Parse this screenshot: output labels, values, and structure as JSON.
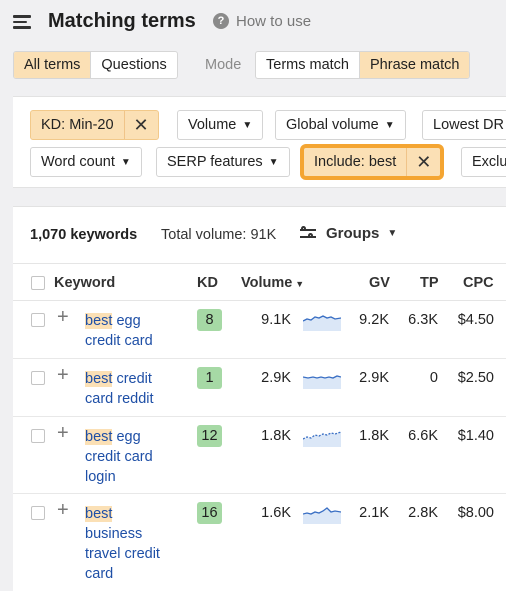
{
  "header": {
    "title": "Matching terms",
    "help_icon_glyph": "?",
    "help_text": "How to use"
  },
  "tabs": {
    "all_terms": "All terms",
    "questions": "Questions",
    "mode_label": "Mode",
    "terms_match": "Terms match",
    "phrase_match": "Phrase match"
  },
  "filters": {
    "kd": "KD: Min-20",
    "volume": "Volume",
    "global_volume": "Global volume",
    "lowest_dr": "Lowest DR",
    "word_count": "Word count",
    "serp_features": "SERP features",
    "include": "Include: best",
    "exclude": "Exclude",
    "close_glyph": "✕",
    "caret_glyph": "▼"
  },
  "summary": {
    "keywords": "1,070 keywords",
    "total_volume": "Total volume: 91K",
    "groups_label": "Groups"
  },
  "columns": {
    "keyword": "Keyword",
    "kd": "KD",
    "volume": "Volume",
    "gv": "GV",
    "tp": "TP",
    "cpc": "CPC"
  },
  "rows": [
    {
      "match": "best",
      "rest_lines": [
        "egg",
        "credit card"
      ],
      "kd": "8",
      "volume": "9.1K",
      "gv": "9.2K",
      "tp": "6.3K",
      "cpc": "$4.50"
    },
    {
      "match": "best",
      "rest_lines": [
        "credit",
        "card reddit"
      ],
      "kd": "1",
      "volume": "2.9K",
      "gv": "2.9K",
      "tp": "0",
      "cpc": "$2.50"
    },
    {
      "match": "best",
      "rest_lines": [
        "egg",
        "credit card",
        "login"
      ],
      "kd": "12",
      "volume": "1.8K",
      "gv": "1.8K",
      "tp": "6.6K",
      "cpc": "$1.40"
    },
    {
      "match": "best",
      "rest_lines": [
        "",
        "business",
        "travel credit",
        "card"
      ],
      "kd": "16",
      "volume": "1.6K",
      "gv": "2.1K",
      "tp": "2.8K",
      "cpc": "$8.00"
    }
  ],
  "colors": {
    "accent_active": "#fbe0b5",
    "highlight_ring": "#f4a532",
    "kd_easy": "#a6d9a5",
    "link": "#1e4fa6"
  },
  "icons": {
    "menu": "hamburger-icon",
    "help": "question-circle-icon",
    "groups": "sliders-icon",
    "add": "plus-icon",
    "trend": "sparkline-icon"
  }
}
